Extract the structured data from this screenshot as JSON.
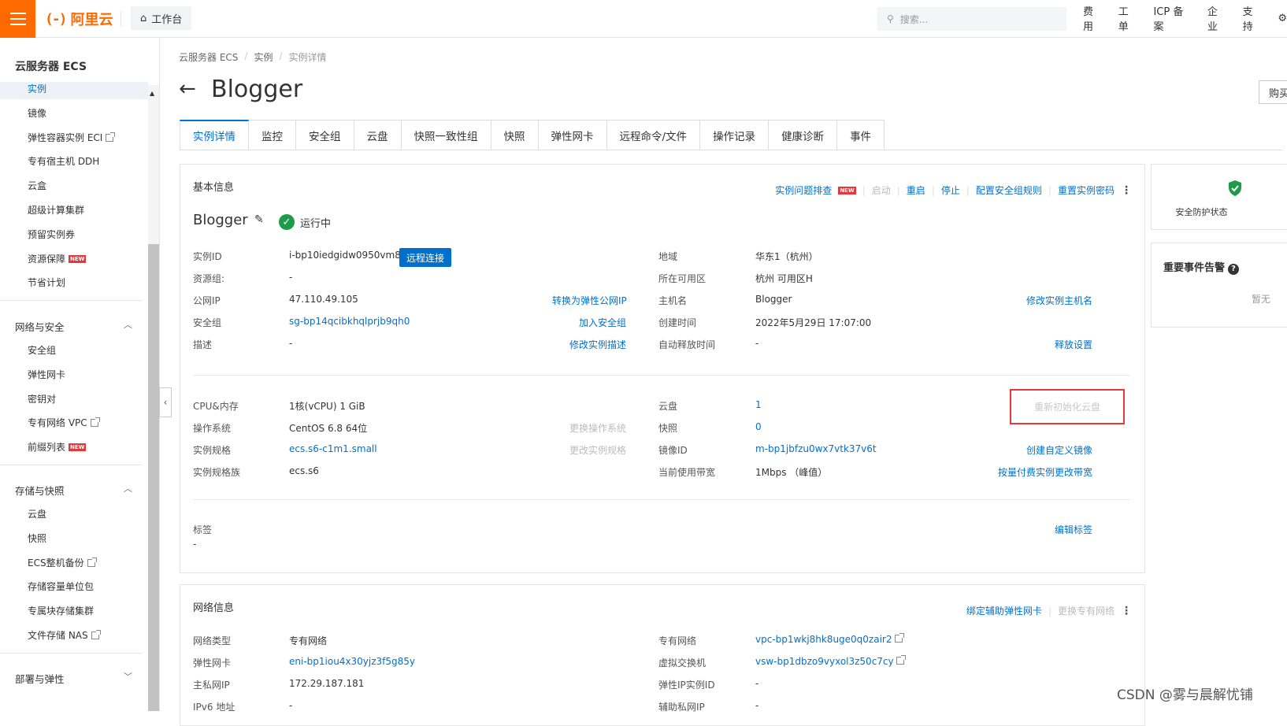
{
  "topbar": {
    "logo_text": "阿里云",
    "logo_bracket": "(-)",
    "workbench": "工作台",
    "search_placeholder": "搜索...",
    "nav": [
      "费用",
      "工单",
      "ICP 备案",
      "企业",
      "支持"
    ]
  },
  "sidebar": {
    "title": "云服务器 ECS",
    "items": [
      {
        "label": "实例",
        "active": true
      },
      {
        "label": "镜像"
      },
      {
        "label": "弹性容器实例 ECI",
        "ext": true
      },
      {
        "label": "专有宿主机 DDH"
      },
      {
        "label": "云盒"
      },
      {
        "label": "超级计算集群"
      },
      {
        "label": "预留实例券"
      },
      {
        "label": "资源保障",
        "badge": "NEW"
      },
      {
        "label": "节省计划"
      }
    ],
    "group_network": "网络与安全",
    "network_items": [
      {
        "label": "安全组"
      },
      {
        "label": "弹性网卡"
      },
      {
        "label": "密钥对"
      },
      {
        "label": "专有网络 VPC",
        "ext": true
      },
      {
        "label": "前缀列表",
        "badge": "NEW"
      }
    ],
    "group_storage": "存储与快照",
    "storage_items": [
      {
        "label": "云盘"
      },
      {
        "label": "快照"
      },
      {
        "label": "ECS整机备份",
        "ext": true
      },
      {
        "label": "存储容量单位包"
      },
      {
        "label": "专属块存储集群"
      },
      {
        "label": "文件存储 NAS",
        "ext": true
      }
    ],
    "group_deploy": "部署与弹性",
    "new_badge": "NEW"
  },
  "breadcrumb": [
    "云服务器 ECS",
    "实例",
    "实例详情"
  ],
  "page_title": "Blogger",
  "buy_button": "购买",
  "tabs": [
    "实例详情",
    "监控",
    "安全组",
    "云盘",
    "快照一致性组",
    "快照",
    "弹性网卡",
    "远程命令/文件",
    "操作记录",
    "健康诊断",
    "事件"
  ],
  "basic": {
    "title": "基本信息",
    "actions": {
      "troubleshoot": "实例问题排查",
      "start": "启动",
      "restart": "重启",
      "stop": "停止",
      "config_sg": "配置安全组规则",
      "reset_pwd": "重置实例密码"
    },
    "instance_name": "Blogger",
    "status": "运行中",
    "left": {
      "instance_id_label": "实例ID",
      "instance_id": "i-bp10iedgidw0950vm8fp",
      "remote": "远程连接",
      "rg_label": "资源组:",
      "rg": "-",
      "pubip_label": "公网IP",
      "pubip": "47.110.49.105",
      "to_eip": "转换为弹性公网IP",
      "sg_label": "安全组",
      "sg": "sg-bp14qcibkhqlprjb9qh0",
      "join_sg": "加入安全组",
      "desc_label": "描述",
      "desc": "-",
      "edit_desc": "修改实例描述"
    },
    "right": {
      "region_label": "地域",
      "region": "华东1（杭州）",
      "zone_label": "所在可用区",
      "zone": "杭州 可用区H",
      "host_label": "主机名",
      "host": "Blogger",
      "edit_host": "修改实例主机名",
      "created_label": "创建时间",
      "created": "2022年5月29日 17:07:00",
      "release_label": "自动释放时间",
      "release": "-",
      "release_set": "释放设置"
    },
    "spec": {
      "cpu_label": "CPU&内存",
      "cpu": "1核(vCPU) 1 GiB",
      "os_label": "操作系统",
      "os": "CentOS 6.8 64位",
      "change_os": "更换操作系统",
      "type_label": "实例规格",
      "type": "ecs.s6-c1m1.small",
      "change_type": "更改实例规格",
      "family_label": "实例规格族",
      "family": "ecs.s6",
      "disk_label": "云盘",
      "disk": "1",
      "reinit": "重新初始化云盘",
      "snap_label": "快照",
      "snap": "0",
      "image_label": "镜像ID",
      "image": "m-bp1jbfzu0wx7vtk37v6t",
      "custom_image": "创建自定义镜像",
      "bw_label": "当前使用带宽",
      "bw": "1Mbps （峰值）",
      "change_bw": "按量付费实例更改带宽"
    },
    "tags_label": "标签",
    "tags_value": "-",
    "edit_tags": "编辑标签"
  },
  "network": {
    "title": "网络信息",
    "bind_eni": "绑定辅助弹性网卡",
    "change_vpc": "更换专有网络",
    "type_label": "网络类型",
    "type": "专有网络",
    "eni_label": "弹性网卡",
    "eni": "eni-bp1iou4x30yjz3f5g85y",
    "priv_label": "主私网IP",
    "priv": "172.29.187.181",
    "ipv6_label": "IPv6 地址",
    "ipv6": "-",
    "vpc_label": "专有网络",
    "vpc": "vpc-bp1wkj8hk8uge0q0zair2",
    "vsw_label": "虚拟交换机",
    "vsw": "vsw-bp1dbzo9vyxol3z50c7cy",
    "eip_label": "弹性IP实例ID",
    "eip": "-",
    "sec_priv_label": "辅助私网IP",
    "sec_priv": "-"
  },
  "right_panel": {
    "protect": "安全防护状态",
    "events_title": "重要事件告警",
    "events_empty": "暂无"
  },
  "watermark": "CSDN @雾与晨解忧铺",
  "colors": {
    "brand": "#ff6a00",
    "link": "#0070cc",
    "ok": "#1e9b48",
    "alert": "#e4393c"
  }
}
